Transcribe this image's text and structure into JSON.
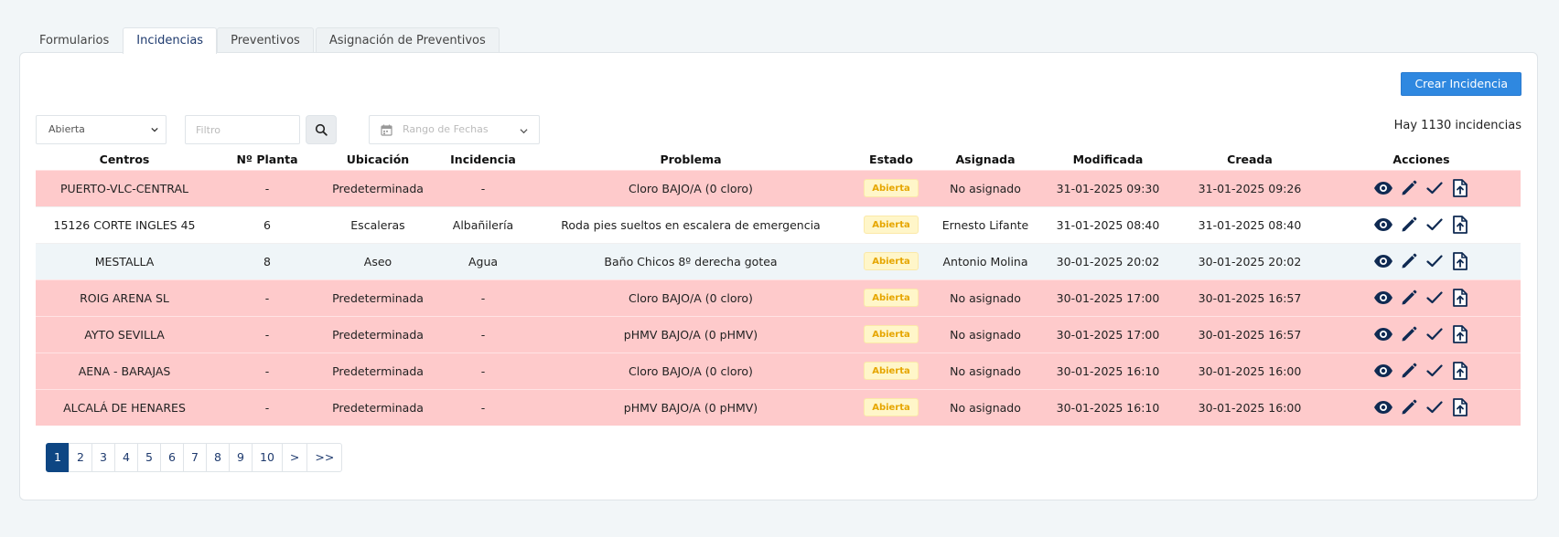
{
  "tabs": [
    "Formularios",
    "Incidencias",
    "Preventivos",
    "Asignación de Preventivos"
  ],
  "active_tab": "Incidencias",
  "toolbar": {
    "create_label": "Crear Incidencia",
    "count_text": "Hay 1130 incidencias"
  },
  "filters": {
    "status_value": "Abierta",
    "filter_placeholder": "Filtro",
    "date_placeholder": "Rango de Fechas"
  },
  "columns": [
    "Centros",
    "Nº Planta",
    "Ubicación",
    "Incidencia",
    "Problema",
    "Estado",
    "Asignada",
    "Modificada",
    "Creada",
    "Acciones"
  ],
  "rows": [
    {
      "centro": "PUERTO-VLC-CENTRAL",
      "planta": "-",
      "ubicacion": "Predeterminada",
      "incidencia": "-",
      "problema": "Cloro BAJO/A (0 cloro)",
      "estado": "Abierta",
      "asignada": "No asignado",
      "modificada": "31-01-2025 09:30",
      "creada": "31-01-2025 09:26",
      "highlight": "pink"
    },
    {
      "centro": "15126 CORTE INGLES 45",
      "planta": "6",
      "ubicacion": "Escaleras",
      "incidencia": "Albañilería",
      "problema": "Roda pies sueltos en escalera de emergencia",
      "estado": "Abierta",
      "asignada": "Ernesto Lifante",
      "modificada": "31-01-2025 08:40",
      "creada": "31-01-2025 08:40",
      "highlight": "white"
    },
    {
      "centro": "MESTALLA",
      "planta": "8",
      "ubicacion": "Aseo",
      "incidencia": "Agua",
      "problema": "Baño Chicos 8º derecha gotea",
      "estado": "Abierta",
      "asignada": "Antonio Molina",
      "modificada": "30-01-2025 20:02",
      "creada": "30-01-2025 20:02",
      "highlight": "blue"
    },
    {
      "centro": "ROIG ARENA SL",
      "planta": "-",
      "ubicacion": "Predeterminada",
      "incidencia": "-",
      "problema": "Cloro BAJO/A (0 cloro)",
      "estado": "Abierta",
      "asignada": "No asignado",
      "modificada": "30-01-2025 17:00",
      "creada": "30-01-2025 16:57",
      "highlight": "pink"
    },
    {
      "centro": "AYTO SEVILLA",
      "planta": "-",
      "ubicacion": "Predeterminada",
      "incidencia": "-",
      "problema": "pHMV BAJO/A (0 pHMV)",
      "estado": "Abierta",
      "asignada": "No asignado",
      "modificada": "30-01-2025 17:00",
      "creada": "30-01-2025 16:57",
      "highlight": "pink"
    },
    {
      "centro": "AENA - BARAJAS",
      "planta": "-",
      "ubicacion": "Predeterminada",
      "incidencia": "-",
      "problema": "Cloro BAJO/A (0 cloro)",
      "estado": "Abierta",
      "asignada": "No asignado",
      "modificada": "30-01-2025 16:10",
      "creada": "30-01-2025 16:00",
      "highlight": "pink"
    },
    {
      "centro": "ALCALÁ DE HENARES",
      "planta": "-",
      "ubicacion": "Predeterminada",
      "incidencia": "-",
      "problema": "pHMV BAJO/A (0 pHMV)",
      "estado": "Abierta",
      "asignada": "No asignado",
      "modificada": "30-01-2025 16:10",
      "creada": "30-01-2025 16:00",
      "highlight": "pink"
    }
  ],
  "row_actions": [
    "eye-icon",
    "pencil-icon",
    "check-icon",
    "file-upload-icon"
  ],
  "pagination": {
    "pages": [
      "1",
      "2",
      "3",
      "4",
      "5",
      "6",
      "7",
      "8",
      "9",
      "10",
      ">",
      ">>"
    ],
    "active": "1"
  },
  "colors": {
    "primary": "#2f88e0",
    "active_page": "#0e4683",
    "row_highlight": "#fecacb",
    "badge_text": "#e6a600",
    "badge_bg": "#fff6c9",
    "icon": "#0f2a52"
  }
}
